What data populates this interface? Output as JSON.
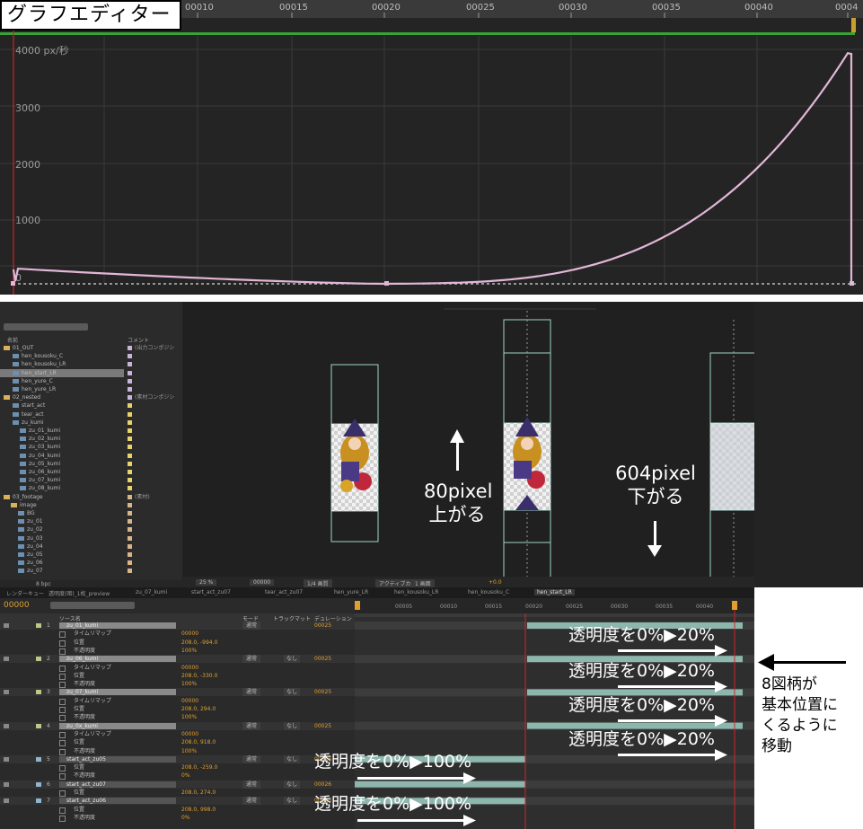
{
  "graph_editor": {
    "title": "グラフエディター",
    "ruler_ticks": [
      "00010",
      "00015",
      "00020",
      "00025",
      "00030",
      "00035",
      "00040",
      "0004"
    ],
    "y_unit_label": "4000 px/秒",
    "y_ticks": [
      "3000",
      "2000",
      "1000",
      "0"
    ],
    "curve_color": "#e2b6d7"
  },
  "project_panel": {
    "header_name": "名前",
    "header_comment": "コメント",
    "items": [
      {
        "label": "01_OUT",
        "comment": "(出力コンポジシ"
      },
      {
        "label": "hen_kousoku_C",
        "comment": ""
      },
      {
        "label": "hen_kousoku_LR",
        "comment": ""
      },
      {
        "label": "hen_start_LR",
        "comment": ""
      },
      {
        "label": "hen_yure_C",
        "comment": ""
      },
      {
        "label": "hen_yure_LR",
        "comment": ""
      },
      {
        "label": "02_nested",
        "comment": "(素材コンポジシ"
      },
      {
        "label": "start_act",
        "comment": ""
      },
      {
        "label": "tear_act",
        "comment": ""
      },
      {
        "label": "zu_kumi",
        "comment": ""
      },
      {
        "label": "zu_01_kumi",
        "comment": ""
      },
      {
        "label": "zu_02_kumi",
        "comment": ""
      },
      {
        "label": "zu_03_kumi",
        "comment": ""
      },
      {
        "label": "zu_04_kumi",
        "comment": ""
      },
      {
        "label": "zu_05_kumi",
        "comment": ""
      },
      {
        "label": "zu_06_kumi",
        "comment": ""
      },
      {
        "label": "zu_07_kumi",
        "comment": ""
      },
      {
        "label": "zu_08_kumi",
        "comment": ""
      },
      {
        "label": "03_footage",
        "comment": "(素材)"
      },
      {
        "label": "image",
        "comment": ""
      },
      {
        "label": "BG",
        "comment": ""
      },
      {
        "label": "zu_01",
        "comment": ""
      },
      {
        "label": "zu_02",
        "comment": ""
      },
      {
        "label": "zu_03",
        "comment": ""
      },
      {
        "label": "zu_04",
        "comment": ""
      },
      {
        "label": "zu_05",
        "comment": ""
      },
      {
        "label": "zu_06",
        "comment": ""
      },
      {
        "label": "zu_07",
        "comment": ""
      }
    ],
    "footer_bpc": "8 bpc"
  },
  "composition": {
    "up_label_line1": "80pixel",
    "up_label_line2": "上がる",
    "down_label_line1": "604pixel",
    "down_label_line2": "下がる",
    "zoom": "25 %",
    "timecode": "00000",
    "quality": "1/4 画質",
    "camera": "アクティブカメラ",
    "views": "1 画面",
    "exposure": "+0.0"
  },
  "timeline": {
    "tabs": [
      "レンダーキュー",
      "透明度(暗)_1枚_preview",
      "zu_07_kumi",
      "start_act_zu07",
      "tear_act_zu07",
      "hen_yure_LR",
      "hen_kousoku_LR",
      "hen_kousoku_C",
      "hen_start_LR"
    ],
    "active_tab": "hen_start_LR",
    "current_time": "00000",
    "col_source": "ソース名",
    "col_mode": "モード",
    "col_trkmat": "トラックマット",
    "col_duration": "デュレーション",
    "ruler_ticks": [
      "00005",
      "00010",
      "00015",
      "00020",
      "00025",
      "00030",
      "00035",
      "00040"
    ],
    "layers": [
      {
        "num": "1",
        "name": "zu_01_kumi",
        "mode": "通常",
        "parent": "",
        "duration": "00025",
        "props": [
          {
            "name": "タイムリマップ",
            "value": "00000"
          },
          {
            "name": "位置",
            "value": "208.0, -994.0"
          },
          {
            "name": "不透明度",
            "value": "100%"
          }
        ]
      },
      {
        "num": "2",
        "name": "zu_06_kumi",
        "mode": "通常",
        "parent": "なし",
        "duration": "00025",
        "props": [
          {
            "name": "タイムリマップ",
            "value": "00000"
          },
          {
            "name": "位置",
            "value": "208.0, -330.0"
          },
          {
            "name": "不透明度",
            "value": "100%"
          }
        ]
      },
      {
        "num": "3",
        "name": "zu_07_kumi",
        "mode": "通常",
        "parent": "なし",
        "duration": "00025",
        "props": [
          {
            "name": "タイムリマップ",
            "value": "00000"
          },
          {
            "name": "位置",
            "value": "208.0, 294.0"
          },
          {
            "name": "不透明度",
            "value": "100%"
          }
        ]
      },
      {
        "num": "4",
        "name": "zu_0x_kumi",
        "mode": "通常",
        "parent": "なし",
        "duration": "00025",
        "props": [
          {
            "name": "タイムリマップ",
            "value": "00000"
          },
          {
            "name": "位置",
            "value": "208.0, 918.0"
          },
          {
            "name": "不透明度",
            "value": "100%"
          }
        ]
      },
      {
        "num": "5",
        "name": "start_act_zu05",
        "mode": "通常",
        "parent": "なし",
        "duration": "00026",
        "props": [
          {
            "name": "位置",
            "value": "208.0, -259.0"
          },
          {
            "name": "不透明度",
            "value": "0%"
          }
        ]
      },
      {
        "num": "6",
        "name": "start_act_zu07",
        "mode": "通常",
        "parent": "なし",
        "duration": "00026",
        "props": [
          {
            "name": "位置",
            "value": "208.0, 274.0"
          }
        ]
      },
      {
        "num": "7",
        "name": "start_act_zu06",
        "mode": "通常",
        "parent": "なし",
        "duration": "00026",
        "props": [
          {
            "name": "位置",
            "value": "208.0, 998.0"
          },
          {
            "name": "不透明度",
            "value": "0%"
          }
        ]
      }
    ],
    "annotation_20": "透明度を0%▶20%",
    "annotation_100": "透明度を0%▶100%"
  },
  "note": {
    "line1": "8図柄が",
    "line2": "基本位置に",
    "line3": "くるように",
    "line4": "移動"
  }
}
